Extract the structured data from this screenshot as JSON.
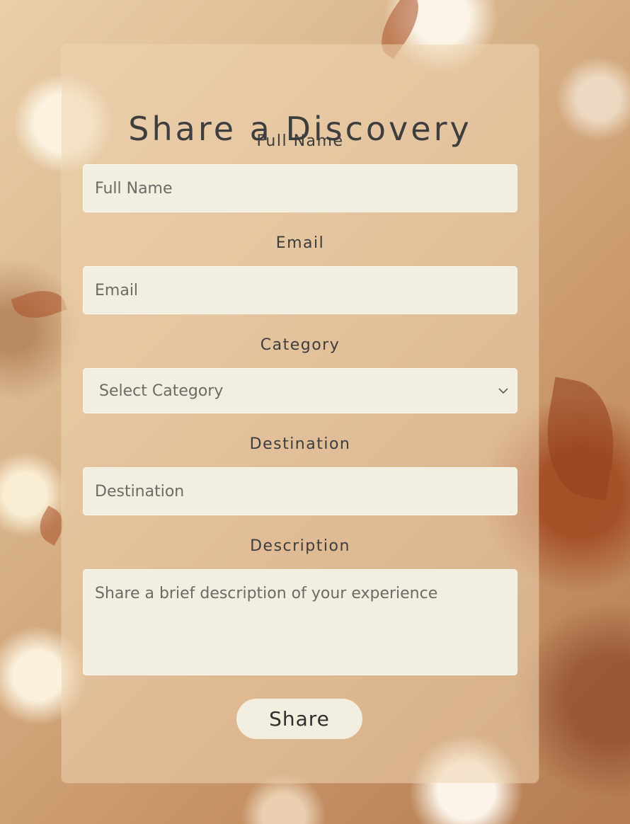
{
  "form": {
    "title": "Share a Discovery",
    "full_name_label": "Full Name",
    "full_name_placeholder": "Full Name",
    "email_label": "Email",
    "email_placeholder": "Email",
    "category_label": "Category",
    "category_selected": "Select Category",
    "destination_label": "Destination",
    "destination_placeholder": "Destination",
    "description_label": "Description",
    "description_placeholder": "Share a brief description of your experience",
    "submit_label": "Share"
  }
}
